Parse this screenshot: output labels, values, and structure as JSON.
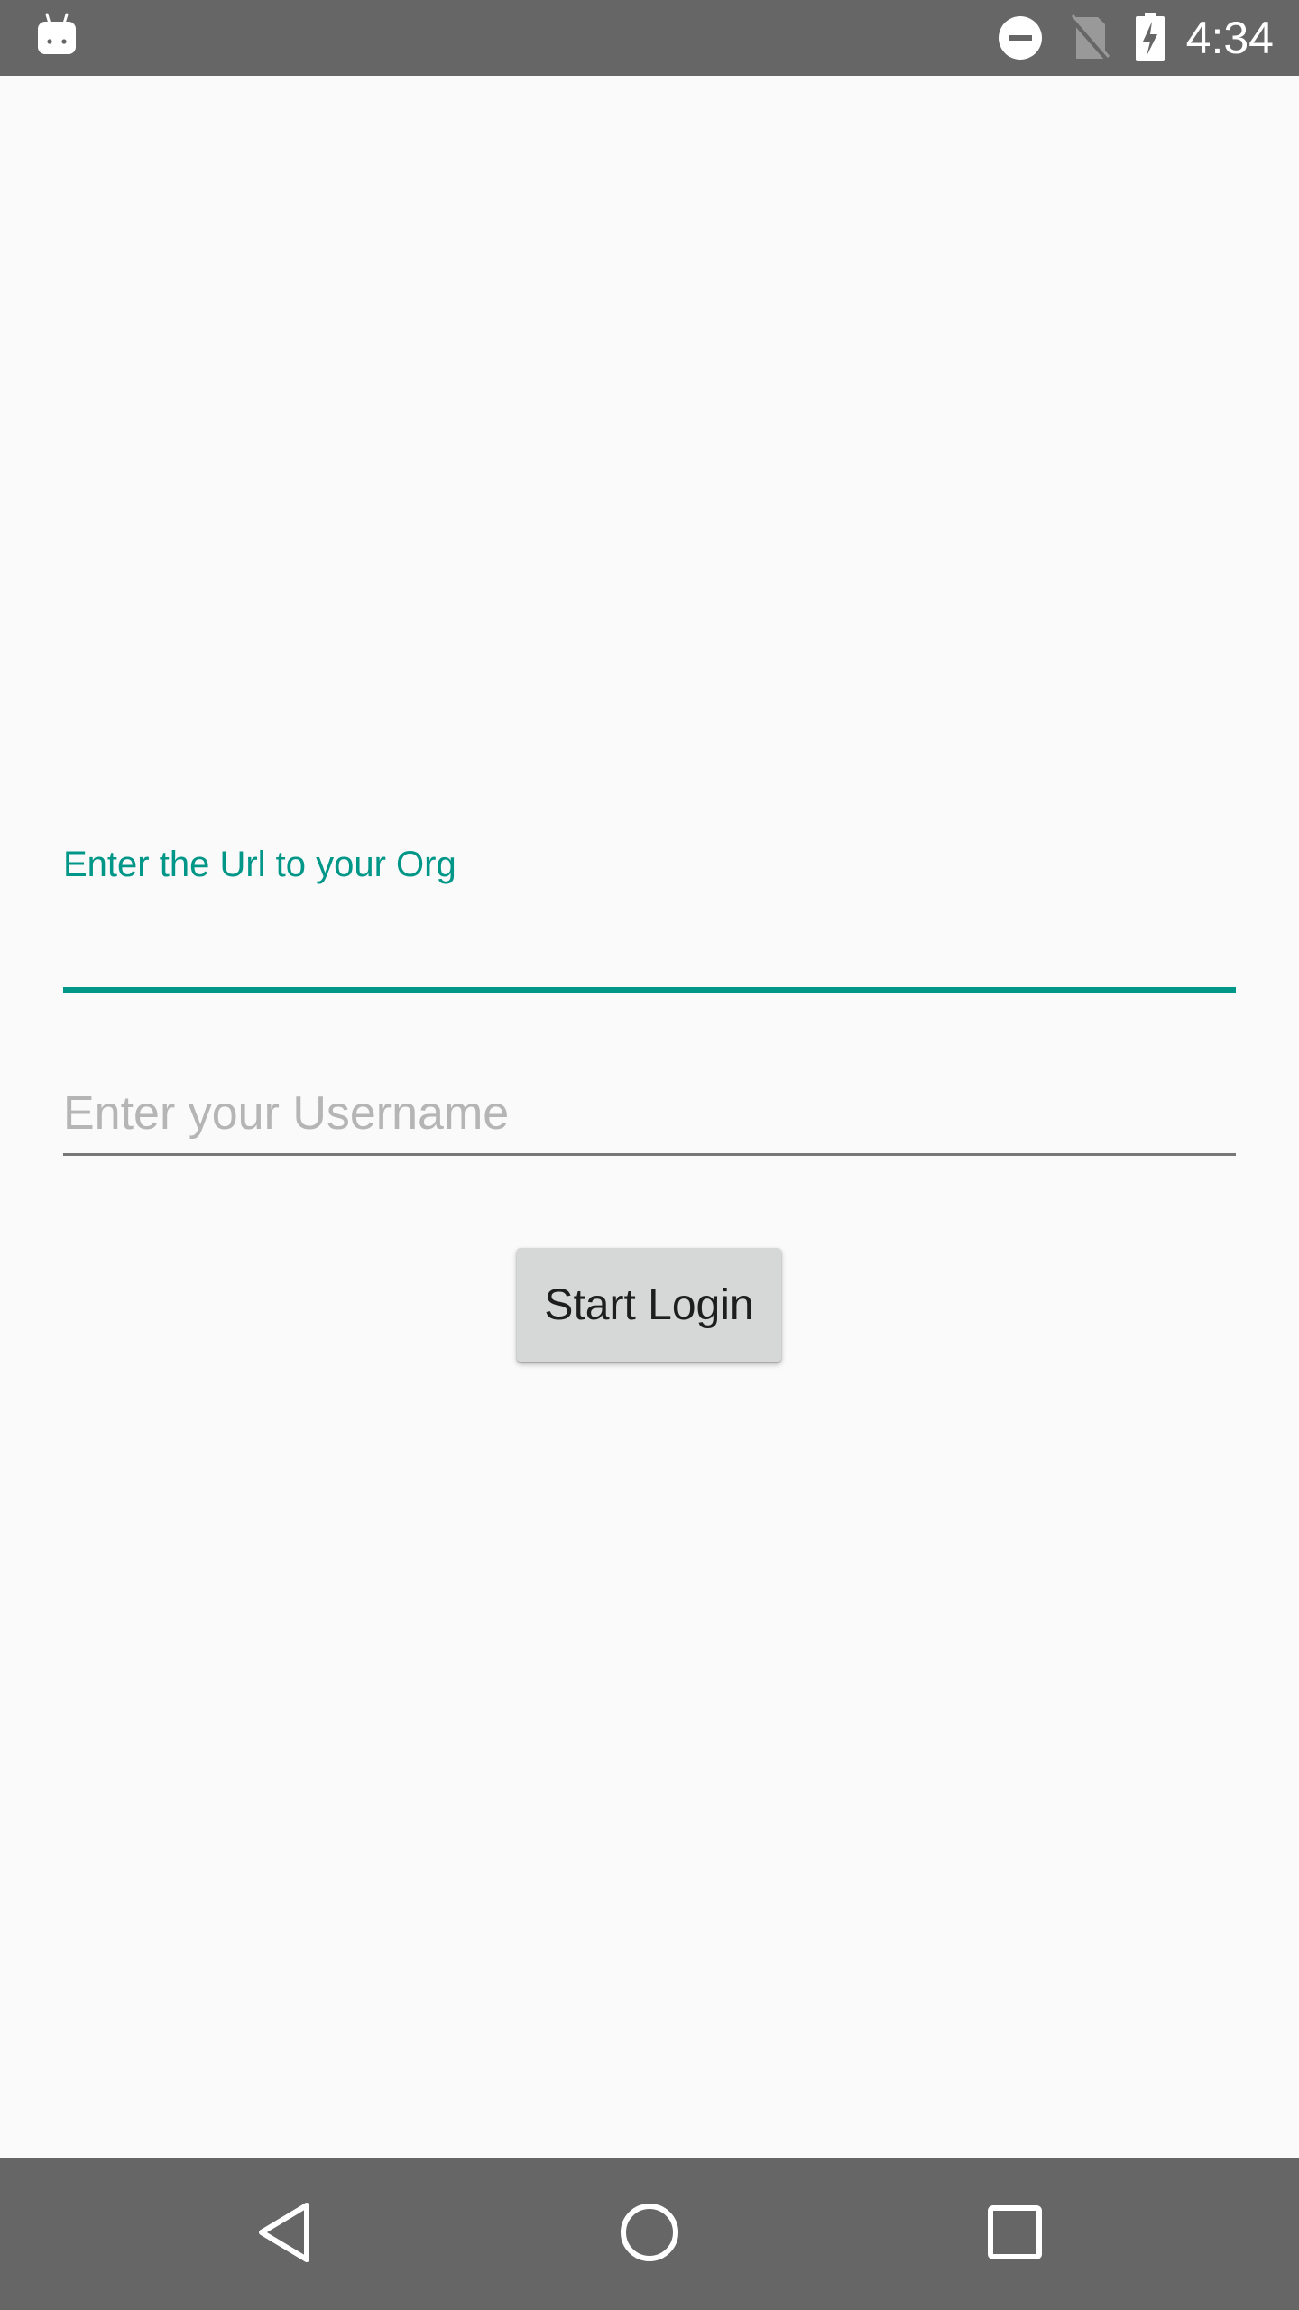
{
  "status_bar": {
    "time": "4:34",
    "icons": [
      "android-debug-icon",
      "do-not-disturb-icon",
      "no-sim-icon",
      "battery-charging-icon"
    ]
  },
  "form": {
    "url_label": "Enter the Url to your Org",
    "url_value": "",
    "username_placeholder": "Enter your Username",
    "username_value": "",
    "login_button_label": "Start Login"
  },
  "nav_bar": {
    "buttons": [
      "back-icon",
      "home-icon",
      "recents-icon"
    ]
  },
  "colors": {
    "accent": "#009688",
    "status_bar_bg": "#666666",
    "nav_bar_bg": "#666666",
    "background": "#fafafa",
    "button_bg": "#d6d7d7",
    "placeholder": "#b5b5b5"
  }
}
